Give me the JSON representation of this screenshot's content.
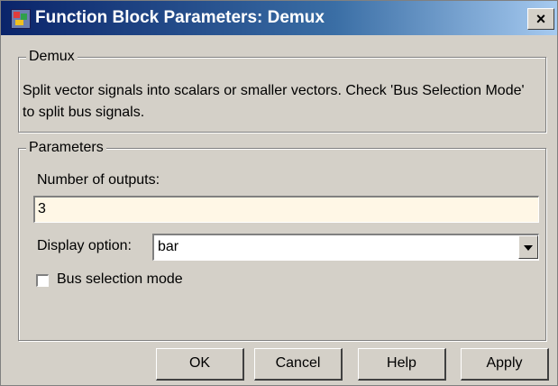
{
  "window": {
    "title": "Function Block Parameters: Demux",
    "close_label": "×"
  },
  "demux_group": {
    "legend": "Demux",
    "description": "Split vector signals into scalars or smaller vectors. Check 'Bus Selection Mode' to split bus signals."
  },
  "params_group": {
    "legend": "Parameters",
    "num_outputs_label": "Number of outputs:",
    "num_outputs_value": "3",
    "display_option_label": "Display option:",
    "display_option_value": "bar",
    "bus_selection_label": "Bus selection mode",
    "bus_selection_checked": false
  },
  "buttons": {
    "ok": "OK",
    "cancel": "Cancel",
    "help": "Help",
    "apply": "Apply"
  },
  "colors": {
    "title_start": "#0a246a",
    "title_end": "#a6caf0",
    "input_bg": "#fff7e6",
    "window_bg": "#d4d0c8"
  }
}
